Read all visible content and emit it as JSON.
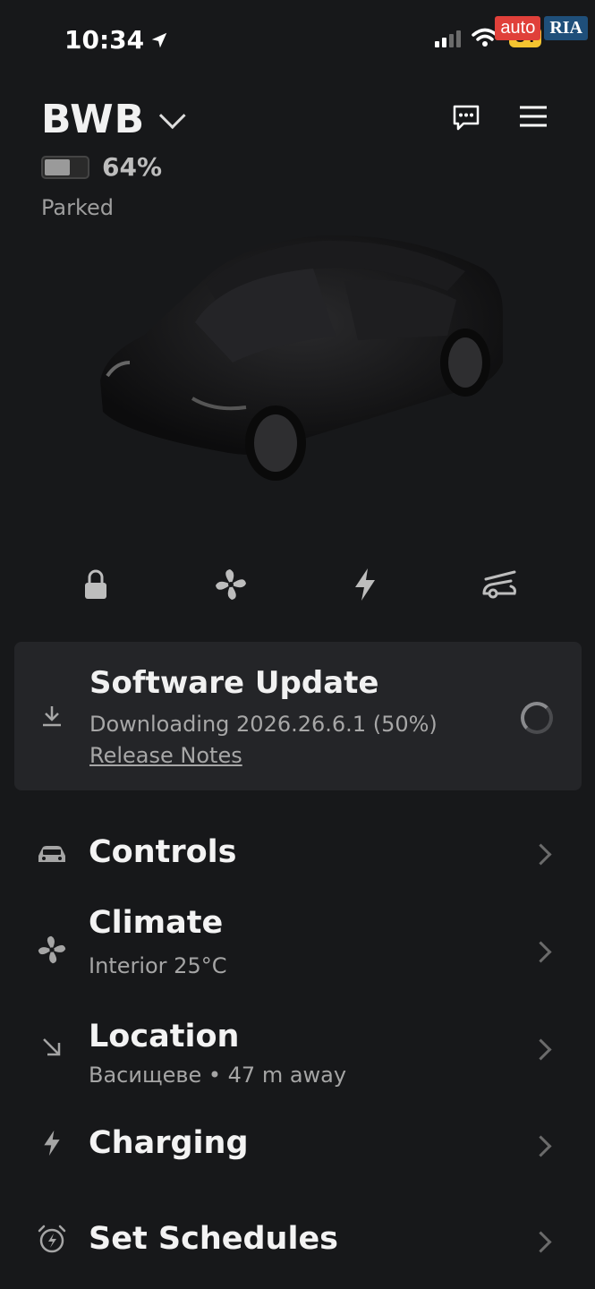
{
  "status_bar": {
    "time": "10:34",
    "battery_level": "84",
    "watermark_auto": "auto",
    "watermark_ria": "RIA"
  },
  "vehicle": {
    "name": "BWB",
    "battery_percent": "64%",
    "battery_fraction": 0.64,
    "state": "Parked"
  },
  "quick_controls": [
    {
      "icon": "lock-icon"
    },
    {
      "icon": "fan-icon"
    },
    {
      "icon": "bolt-icon"
    },
    {
      "icon": "frunk-icon"
    }
  ],
  "software_update": {
    "title": "Software Update",
    "status": "Downloading 2026.26.6.1 (50%)",
    "progress": 0.5,
    "link": "Release Notes"
  },
  "menu": {
    "controls": {
      "title": "Controls"
    },
    "climate": {
      "title": "Climate",
      "subtitle": "Interior 25°C"
    },
    "location": {
      "title": "Location",
      "subtitle": "Васищеве • 47 m away"
    },
    "charging": {
      "title": "Charging"
    },
    "schedules": {
      "title": "Set Schedules"
    }
  },
  "colors": {
    "background": "#17181a",
    "card": "#242528",
    "text": "#f1f1f1",
    "muted": "#a5a5a5"
  }
}
